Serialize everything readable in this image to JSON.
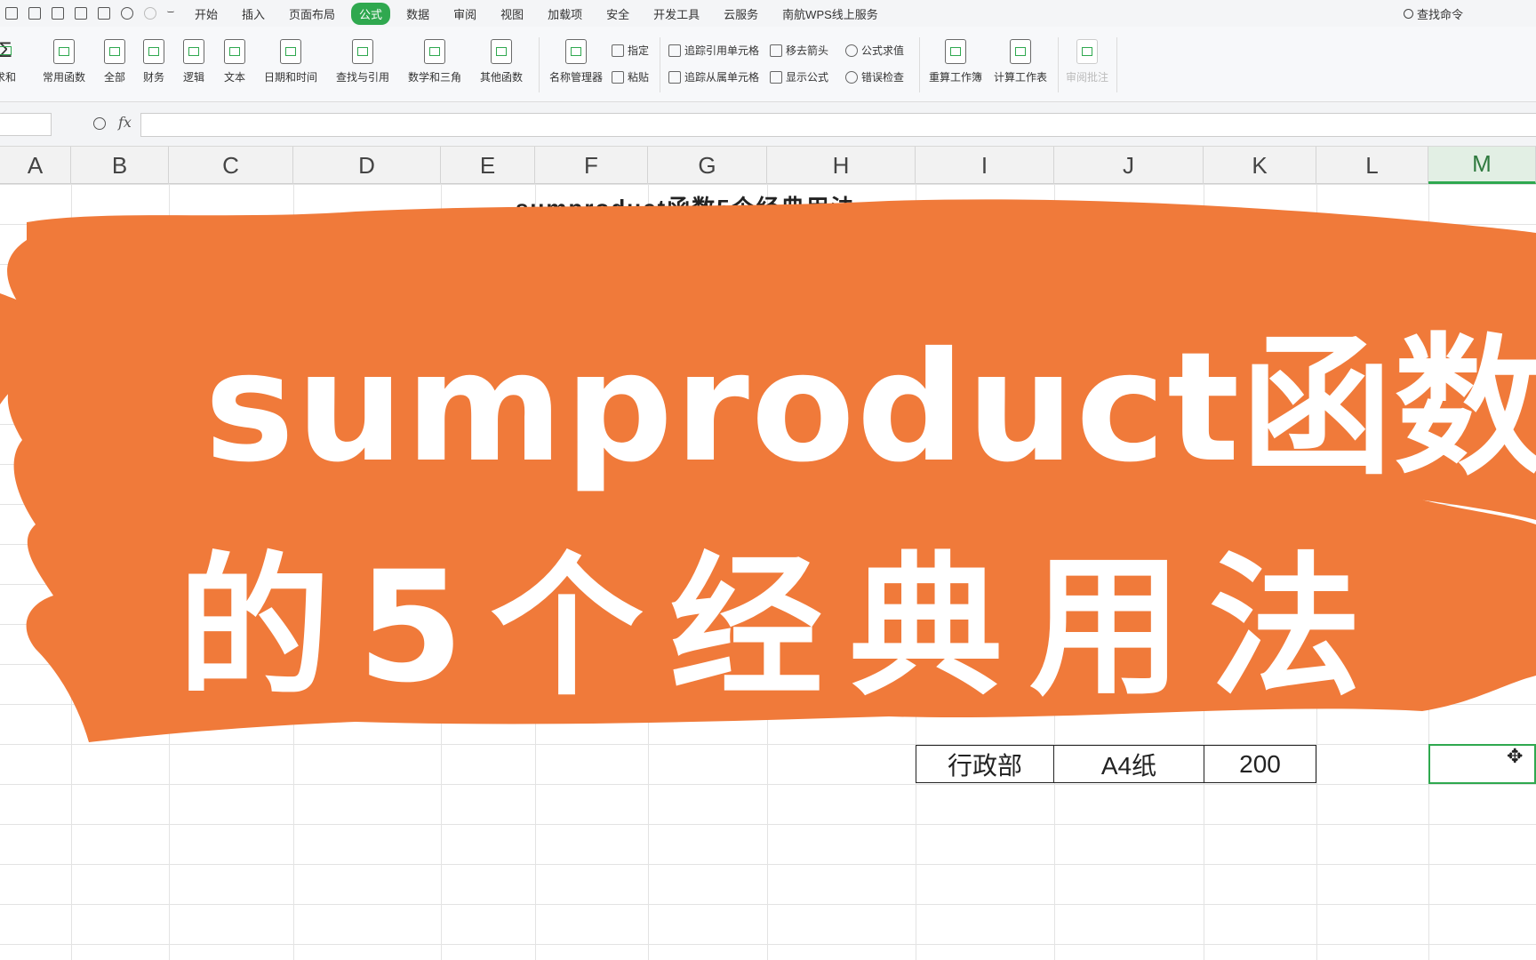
{
  "menu": {
    "tabs": [
      "开始",
      "插入",
      "页面布局",
      "公式",
      "数据",
      "审阅",
      "视图",
      "加载项",
      "安全",
      "开发工具",
      "云服务",
      "南航WPS线上服务"
    ],
    "active_tab": "公式",
    "search_label": "查找命令"
  },
  "ribbon": {
    "autosum": "求和",
    "common_functions": "常用函数",
    "all": "全部",
    "finance": "财务",
    "logic": "逻辑",
    "text": "文本",
    "datetime": "日期和时间",
    "lookup": "查找与引用",
    "math": "数学和三角",
    "other": "其他函数",
    "name_manager": "名称管理器",
    "define": "指定",
    "paste": "粘贴",
    "trace_precedents": "追踪引用单元格",
    "trace_dependents": "追踪从属单元格",
    "remove_arrows": "移去箭头",
    "show_formulas": "显示公式",
    "evaluate": "公式求值",
    "error_check": "错误检查",
    "recalc_workbook": "重算工作簿",
    "calc_sheet": "计算工作表",
    "disabled_item": "审阅批注"
  },
  "formula_bar": {
    "fx": "fx",
    "name_box": "",
    "value": ""
  },
  "columns": [
    "A",
    "B",
    "C",
    "D",
    "E",
    "F",
    "G",
    "H",
    "I",
    "J",
    "K",
    "L",
    "M"
  ],
  "active_column": "M",
  "sheet": {
    "title": "sumproduct函数5个经典用法",
    "visible_row": {
      "dept": "行政部",
      "item": "A4纸",
      "qty": "200"
    }
  },
  "banner": {
    "line1": "sumproduct函数",
    "line2": "的5个经典用法",
    "color": "#f07a3a"
  }
}
